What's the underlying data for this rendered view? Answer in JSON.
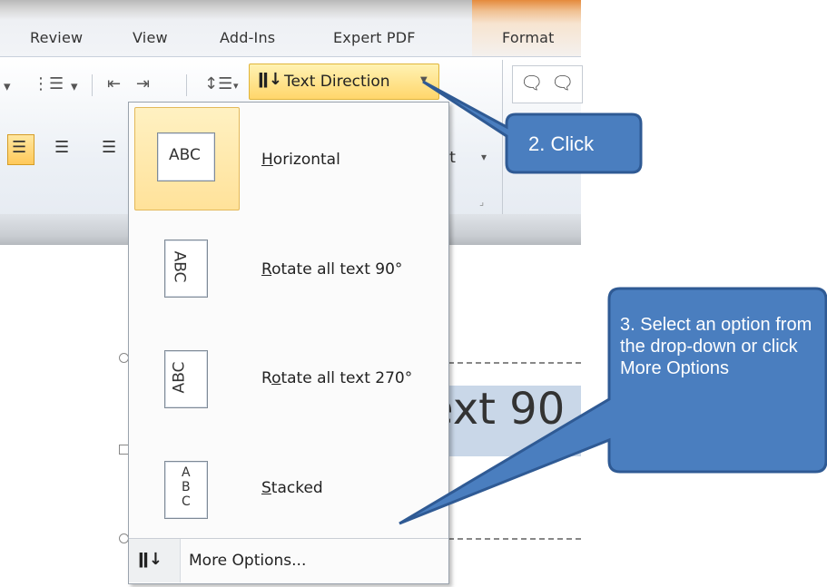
{
  "tabs": [
    {
      "label": "Review"
    },
    {
      "label": "View"
    },
    {
      "label": "Add-Ins"
    },
    {
      "label": "Expert PDF"
    },
    {
      "label": "Format"
    }
  ],
  "ribbon": {
    "text_direction_label": "Text Direction",
    "wordart_fragment": "tArt",
    "wordart_arrow": "▾"
  },
  "dropdown": {
    "items": [
      {
        "label": "Horizontal",
        "accesskey": "H",
        "thumb_text": "ABC"
      },
      {
        "label": "Rotate all text 90°",
        "accesskey": "R",
        "thumb_text": "ABC"
      },
      {
        "label": "Rotate all text 270°",
        "accesskey": "o",
        "thumb_text": "ABC"
      },
      {
        "label": "Stacked",
        "accesskey": "S",
        "thumb_text": "ABC"
      }
    ],
    "more_options": "More Options..."
  },
  "slide": {
    "text_fragment": "ext 90"
  },
  "callouts": {
    "step2": "2. Click",
    "step3": "3. Select an option from the drop-down or click More Options",
    "fill": "#4a7ebf",
    "stroke": "#2f5a94"
  }
}
